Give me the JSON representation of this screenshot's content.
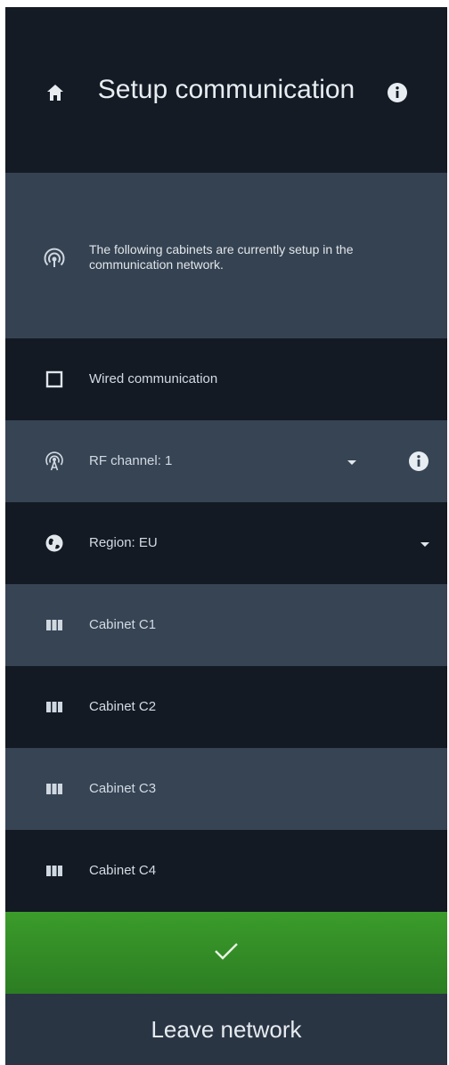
{
  "header": {
    "title": "Setup communication",
    "home_icon": "home-icon",
    "info_icon": "info-icon"
  },
  "info_panel": {
    "icon": "signal-icon",
    "text": "The following cabinets are currently setup in the communication network."
  },
  "rows": [
    {
      "label": "Wired communication",
      "icon": "checkbox-icon"
    },
    {
      "label": "RF channel: 1",
      "icon": "antenna-icon",
      "dropdown": true,
      "info": true
    },
    {
      "label": "Region: EU",
      "icon": "globe-icon",
      "dropdown": true
    },
    {
      "label": "Cabinet C1",
      "icon": "cabinet-icon"
    },
    {
      "label": "Cabinet C2",
      "icon": "cabinet-icon"
    },
    {
      "label": "Cabinet C3",
      "icon": "cabinet-icon"
    },
    {
      "label": "Cabinet C4",
      "icon": "cabinet-icon"
    }
  ],
  "actions": {
    "confirm_icon": "checkmark-icon",
    "leave_label": "Leave network"
  },
  "colors": {
    "header_bg": "#141b24",
    "panel_light": "#354252",
    "row_dark": "#131a23",
    "row_light": "#364454",
    "confirm_green": "#3b9c2b",
    "leave_bg": "#2a3544"
  }
}
